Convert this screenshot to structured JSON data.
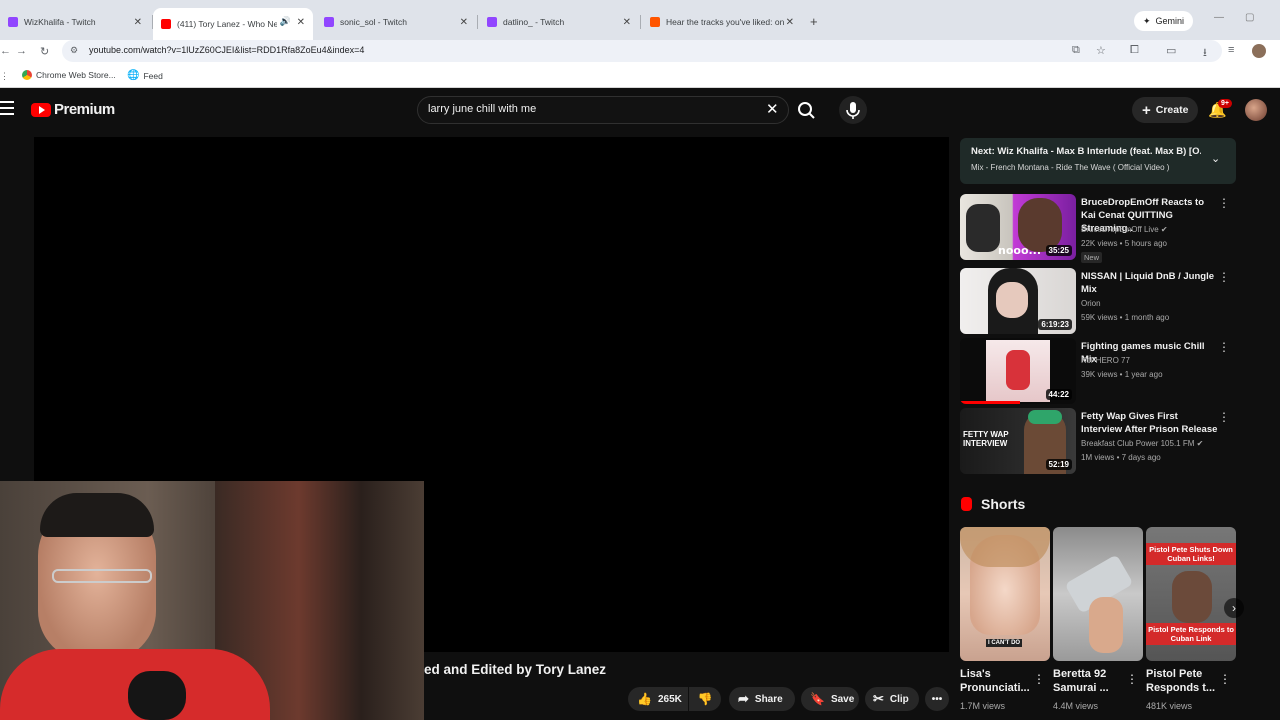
{
  "browser": {
    "tabs": [
      {
        "title": "WizKhalifa - Twitch",
        "favicon": "twitch-icon"
      },
      {
        "title": "(411) Tory Lanez - Who Ne",
        "favicon": "youtube-icon",
        "active": true
      },
      {
        "title": "sonic_sol - Twitch",
        "favicon": "twitch-icon"
      },
      {
        "title": "datlino_ - Twitch",
        "favicon": "twitch-icon"
      },
      {
        "title": "Hear the tracks you've liked: on",
        "favicon": "soundcloud-icon"
      }
    ],
    "gemini_label": "Gemini",
    "url": "youtube.com/watch?v=1lUzZ60CJEI&list=RDD1Rfa8ZoEu4&index=4",
    "bookmarks": [
      {
        "label": "Chrome Web Store..."
      },
      {
        "label": "Feed"
      }
    ]
  },
  "youtube": {
    "logo_text": "Premium",
    "search_value": "larry june chill with me",
    "create_label": "Create",
    "notif_badge": "9+",
    "video_title_fragment": "ed and Edited by Tory Lanez",
    "actions": {
      "likes": "265K",
      "share": "Share",
      "save": "Save",
      "clip": "Clip"
    },
    "next": {
      "prefix": "Next:",
      "title": "Wiz Khalifa - Max B Interlude (feat. Max B) [O...",
      "sub": "Mix - French Montana - Ride The Wave ( Official Video )"
    },
    "related": [
      {
        "title": "BruceDropEmOff Reacts to Kai Cenat QUITTING Streaming..",
        "channel": "BruceDropEmOff Live",
        "meta": "22K views • 5 hours ago",
        "duration": "35:25",
        "badge": "New",
        "thumb_text": "nooo..."
      },
      {
        "title": "NISSAN | Liquid DnB / Jungle Mix",
        "channel": "Orion",
        "meta": "59K views • 1 month ago",
        "duration": "6:19:23"
      },
      {
        "title": "Fighting games music Chill Mix",
        "channel": "KoFHERO 77",
        "meta": "39K views • 1 year ago",
        "duration": "44:22"
      },
      {
        "title": "Fetty Wap Gives First Interview After Prison Release",
        "channel": "Breakfast Club Power 105.1 FM",
        "meta": "1M views • 7 days ago",
        "duration": "52:19",
        "thumb_text": "FETTY WAP INTERVIEW"
      }
    ],
    "shorts_label": "Shorts",
    "shorts": [
      {
        "title": "Lisa's Pronunciati...",
        "views": "1.7M views",
        "thumb_text": "I CAN'T DO"
      },
      {
        "title": "Beretta 92 Samurai ...",
        "views": "4.4M views"
      },
      {
        "title": "Pistol Pete Responds t...",
        "views": "481K views",
        "thumb_top": "Pistol Pete Shuts Down Cuban Links!",
        "thumb_bottom": "Pistol Pete Responds to Cuban Link"
      }
    ]
  },
  "colors": {
    "yt_red": "#ff0000",
    "bg": "#0f0f0f",
    "next_card": "#1f2a28"
  }
}
